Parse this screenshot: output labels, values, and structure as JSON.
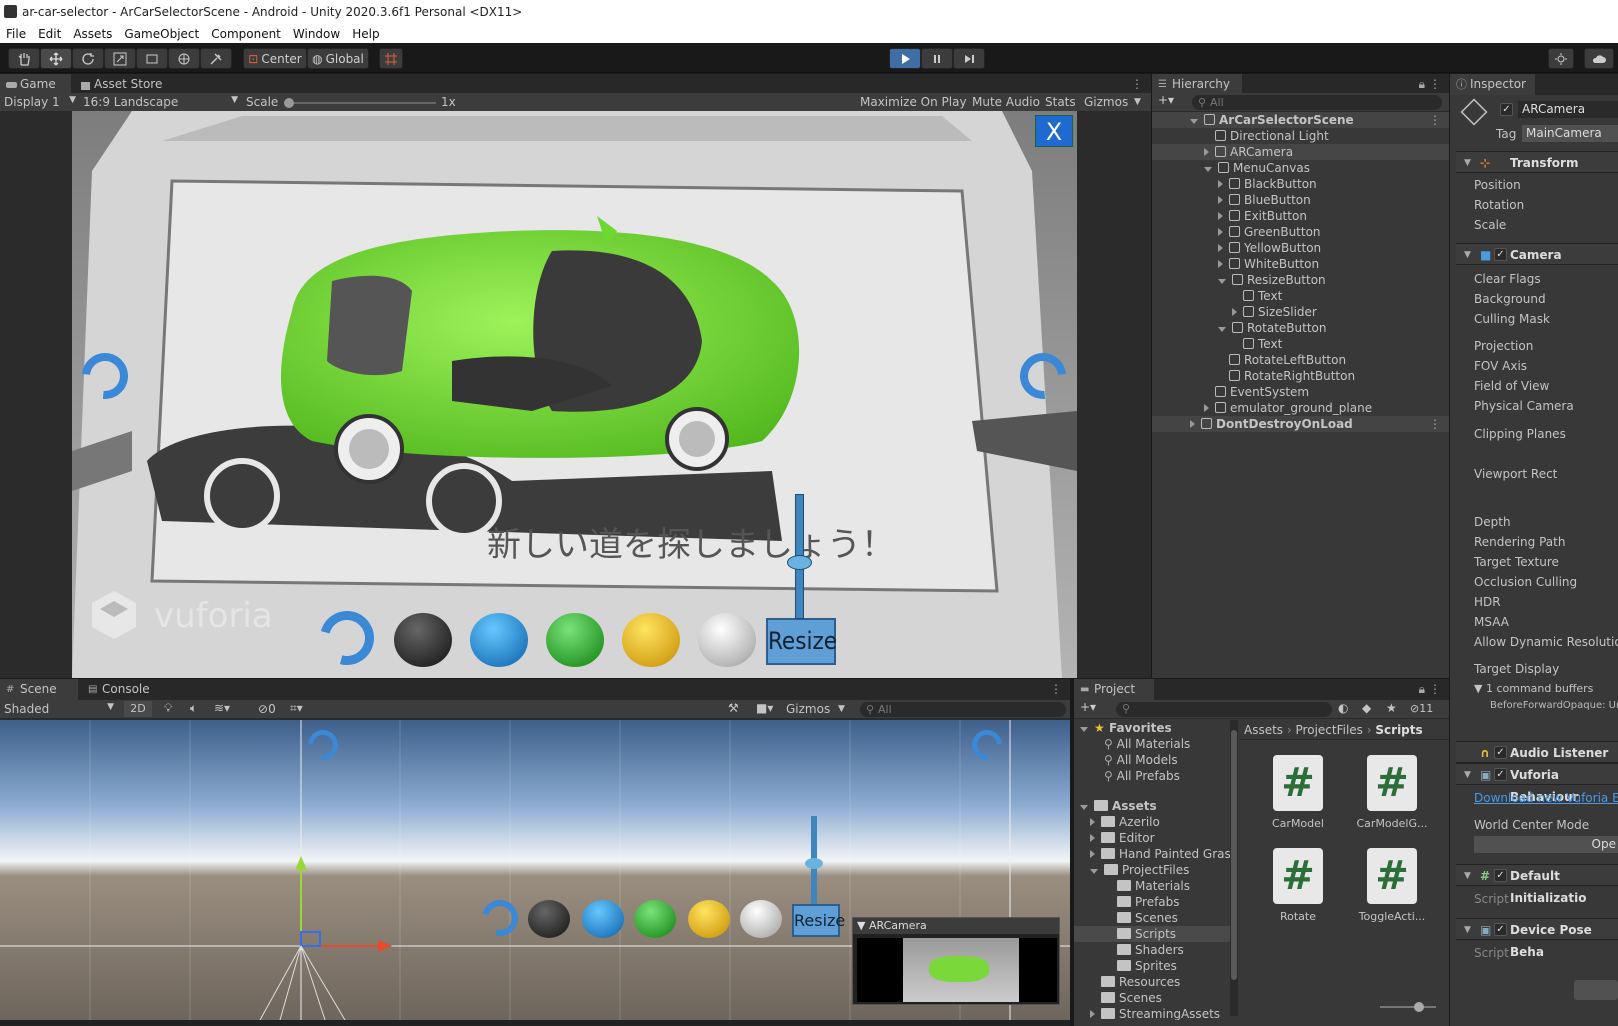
{
  "window": {
    "title": "ar-car-selector - ArCarSelectorScene - Android - Unity 2020.3.6f1 Personal <DX11>"
  },
  "menu": [
    "File",
    "Edit",
    "Assets",
    "GameObject",
    "Component",
    "Window",
    "Help"
  ],
  "toolbar": {
    "pivot": "Center",
    "space": "Global"
  },
  "game": {
    "tabs": [
      "Game",
      "Asset Store"
    ],
    "display": "Display 1",
    "aspect": "16:9 Landscape",
    "scale_label": "Scale",
    "scale_value": "1x",
    "maximize": "Maximize On Play",
    "mute": "Mute Audio",
    "stats": "Stats",
    "gizmos": "Gizmos",
    "close_btn": "X",
    "resize_btn": "Resize",
    "japanese_text": "新しい道を探しましょう！",
    "vuforia": "vuforia"
  },
  "hierarchy": {
    "title": "Hierarchy",
    "search_placeholder": "All",
    "items": [
      {
        "label": "ArCarSelectorScene",
        "level": 0,
        "arrow": "down",
        "type": "scene"
      },
      {
        "label": "Directional Light",
        "level": 1,
        "arrow": "none"
      },
      {
        "label": "ARCamera",
        "level": 1,
        "arrow": "right"
      },
      {
        "label": "MenuCanvas",
        "level": 1,
        "arrow": "down"
      },
      {
        "label": "BlackButton",
        "level": 2,
        "arrow": "right"
      },
      {
        "label": "BlueButton",
        "level": 2,
        "arrow": "right"
      },
      {
        "label": "ExitButton",
        "level": 2,
        "arrow": "right"
      },
      {
        "label": "GreenButton",
        "level": 2,
        "arrow": "right"
      },
      {
        "label": "YellowButton",
        "level": 2,
        "arrow": "right"
      },
      {
        "label": "WhiteButton",
        "level": 2,
        "arrow": "right"
      },
      {
        "label": "ResizeButton",
        "level": 2,
        "arrow": "down"
      },
      {
        "label": "Text",
        "level": 3,
        "arrow": "none"
      },
      {
        "label": "SizeSlider",
        "level": 3,
        "arrow": "right"
      },
      {
        "label": "RotateButton",
        "level": 2,
        "arrow": "down"
      },
      {
        "label": "Text",
        "level": 3,
        "arrow": "none"
      },
      {
        "label": "RotateLeftButton",
        "level": 2,
        "arrow": "none"
      },
      {
        "label": "RotateRightButton",
        "level": 2,
        "arrow": "none"
      },
      {
        "label": "EventSystem",
        "level": 1,
        "arrow": "none"
      },
      {
        "label": "emulator_ground_plane",
        "level": 1,
        "arrow": "right"
      },
      {
        "label": "DontDestroyOnLoad",
        "level": 0,
        "arrow": "right",
        "type": "scene"
      }
    ]
  },
  "inspector": {
    "title": "Inspector",
    "object_name": "ARCamera",
    "tag_label": "Tag",
    "tag_value": "MainCamera",
    "transform": {
      "header": "Transform",
      "fields": [
        "Position",
        "Rotation",
        "Scale"
      ]
    },
    "camera": {
      "header": "Camera",
      "fields": [
        "Clear Flags",
        "Background",
        "Culling Mask",
        "Projection",
        "FOV Axis",
        "Field of View",
        "Physical Camera",
        "Clipping Planes",
        "Viewport Rect",
        "Depth",
        "Rendering Path",
        "Target Texture",
        "Occlusion Culling",
        "HDR",
        "MSAA",
        "Allow Dynamic Resolution",
        "Target Display"
      ],
      "buffers": "1 command buffers",
      "buffer_item": "BeforeForwardOpaque: Un"
    },
    "audio": "Audio Listener",
    "vuforia": "Vuforia Behaviour",
    "vuforia_link": "Download new Vuforia En",
    "world_center": "World Center Mode",
    "open_btn": "Ope",
    "default_init": "Default Initializatio",
    "device_pose": "Device Pose Beha",
    "script_label": "Script"
  },
  "scene": {
    "tabs": [
      "Scene",
      "Console"
    ],
    "shading": "Shaded",
    "mode2d": "2D",
    "hidden_count": "0",
    "gizmos": "Gizmos",
    "search_placeholder": "All",
    "camera_preview_title": "ARCamera",
    "resize_btn": "Resize"
  },
  "project": {
    "title": "Project",
    "hidden_count": "11",
    "breadcrumb": [
      "Assets",
      "ProjectFiles",
      "Scripts"
    ],
    "favorites_title": "Favorites",
    "favorites": [
      "All Materials",
      "All Models",
      "All Prefabs"
    ],
    "assets_title": "Assets",
    "tree": [
      {
        "label": "Azerilo",
        "level": 1,
        "arrow": "right"
      },
      {
        "label": "Editor",
        "level": 1,
        "arrow": "right"
      },
      {
        "label": "Hand Painted Gras",
        "level": 1,
        "arrow": "right"
      },
      {
        "label": "ProjectFiles",
        "level": 1,
        "arrow": "down"
      },
      {
        "label": "Materials",
        "level": 2,
        "arrow": "none"
      },
      {
        "label": "Prefabs",
        "level": 2,
        "arrow": "none"
      },
      {
        "label": "Scenes",
        "level": 2,
        "arrow": "none"
      },
      {
        "label": "Scripts",
        "level": 2,
        "arrow": "none"
      },
      {
        "label": "Shaders",
        "level": 2,
        "arrow": "none"
      },
      {
        "label": "Sprites",
        "level": 2,
        "arrow": "none"
      },
      {
        "label": "Resources",
        "level": 1,
        "arrow": "none"
      },
      {
        "label": "Scenes",
        "level": 1,
        "arrow": "none"
      },
      {
        "label": "StreamingAssets",
        "level": 1,
        "arrow": "right"
      }
    ],
    "files": [
      "CarModel",
      "CarModelG...",
      "Rotate",
      "ToggleActi..."
    ]
  }
}
